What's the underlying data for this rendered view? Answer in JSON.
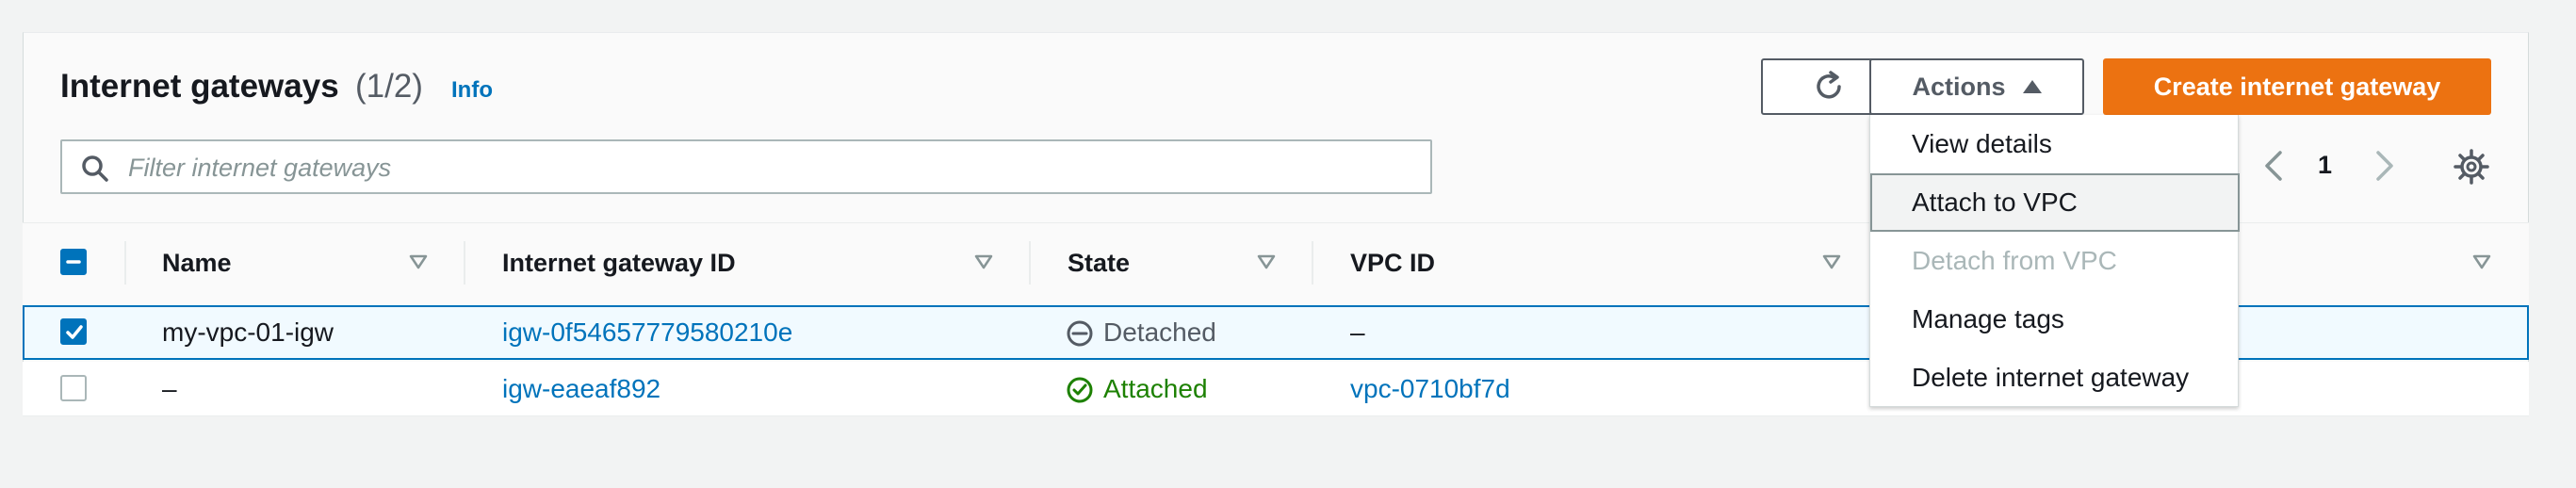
{
  "header": {
    "title": "Internet gateways",
    "count": "(1/2)",
    "info_link": "Info"
  },
  "toolbar": {
    "refresh_icon": "refresh-icon",
    "actions_label": "Actions",
    "create_label": "Create internet gateway"
  },
  "search": {
    "placeholder": "Filter internet gateways",
    "value": ""
  },
  "pagination": {
    "current_page": "1"
  },
  "table": {
    "columns": [
      "Name",
      "Internet gateway ID",
      "State",
      "VPC ID"
    ],
    "rows": [
      {
        "selected": true,
        "name": "my-vpc-01-igw",
        "id": "igw-0f54657779580210e",
        "state": "Detached",
        "vpc": "–"
      },
      {
        "selected": false,
        "name": "–",
        "id": "igw-eaeaf892",
        "state": "Attached",
        "vpc": "vpc-0710bf7d"
      }
    ]
  },
  "actions_menu": {
    "items": [
      {
        "label": "View details",
        "disabled": false
      },
      {
        "label": "Attach to VPC",
        "disabled": false,
        "hovered": true
      },
      {
        "label": "Detach from VPC",
        "disabled": true
      },
      {
        "label": "Manage tags",
        "disabled": false
      },
      {
        "label": "Delete internet gateway",
        "disabled": false
      }
    ]
  },
  "colors": {
    "primary_orange": "#ec7211",
    "link_blue": "#0073bb",
    "attached_green": "#1d8102",
    "detached_gray": "#545b64"
  }
}
